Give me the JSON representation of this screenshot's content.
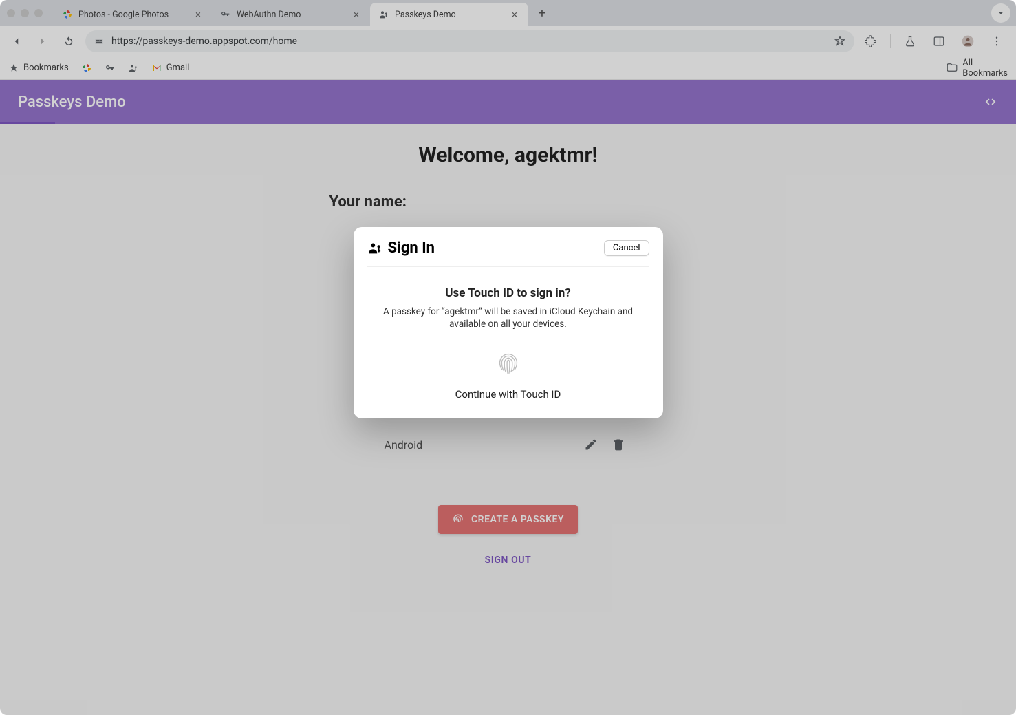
{
  "tabs": [
    {
      "title": "Photos - Google Photos",
      "icon": "photos"
    },
    {
      "title": "WebAuthn Demo",
      "icon": "key"
    },
    {
      "title": "Passkeys Demo",
      "icon": "passkey",
      "active": true
    }
  ],
  "toolbar": {
    "url": "https://passkeys-demo.appspot.com/home"
  },
  "bookmarks": {
    "label": "Bookmarks",
    "gmail_label": "Gmail",
    "all_label": "All Bookmarks"
  },
  "app": {
    "header_title": "Passkeys Demo",
    "code_symbol": "< >"
  },
  "main": {
    "welcome": "Welcome, agektmr!",
    "your_name_label": "Your name:",
    "passkey_row_label": "Android",
    "create_label": "CREATE A PASSKEY",
    "signout_label": "SIGN OUT"
  },
  "dialog": {
    "title": "Sign In",
    "cancel": "Cancel",
    "heading": "Use Touch ID to sign in?",
    "body": "A passkey for “agektmr” will be saved in iCloud Keychain and available on all your devices.",
    "touch_label": "Continue with Touch ID"
  }
}
